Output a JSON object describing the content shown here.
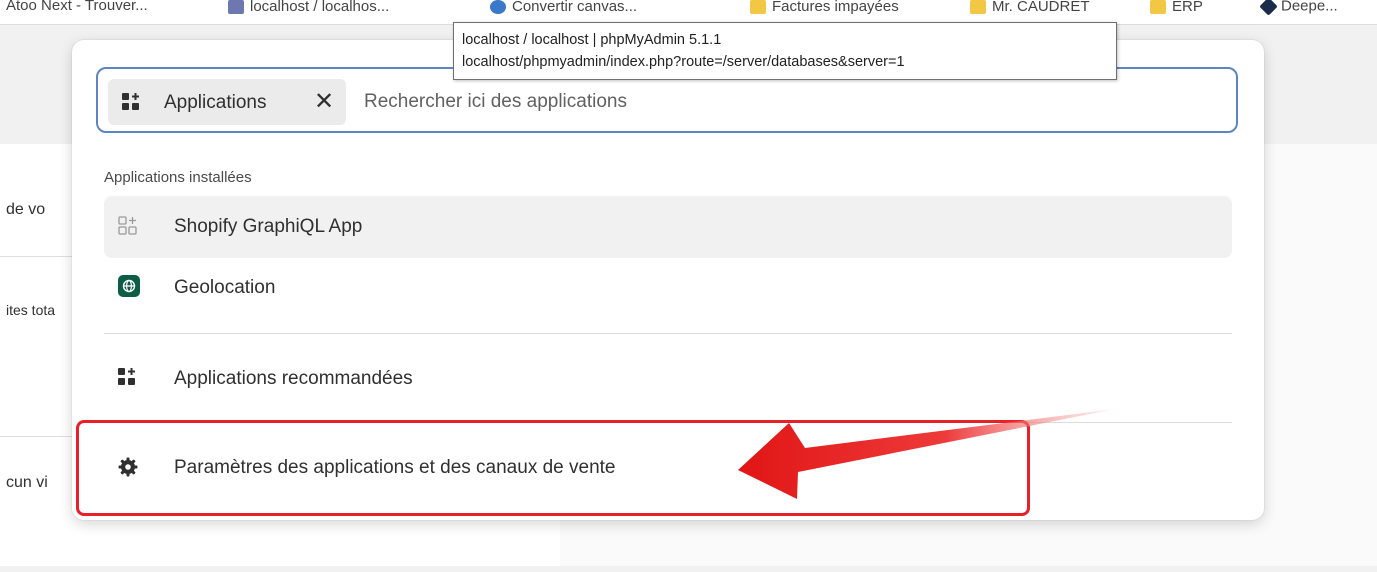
{
  "bookmarks": [
    {
      "label": "Atoo Next - Trouver...",
      "icon": "none"
    },
    {
      "label": "localhost / localhos...",
      "icon": "phpmyadmin-icon"
    },
    {
      "label": "Convertir canvas...",
      "icon": "globe-icon"
    },
    {
      "label": "Factures impayées",
      "icon": "folder-icon"
    },
    {
      "label": "Mr. CAUDRET",
      "icon": "folder-icon"
    },
    {
      "label": "ERP",
      "icon": "folder-icon"
    },
    {
      "label": "Deepe...",
      "icon": "deepl-icon"
    }
  ],
  "background": {
    "text_1": "de vo",
    "text_2": "ites tota",
    "text_3": "cun vi"
  },
  "tooltip": {
    "line1": "localhost / localhost | phpMyAdmin 5.1.1",
    "line2": "localhost/phpmyadmin/index.php?route=/server/databases&server=1"
  },
  "search": {
    "chip_label": "Applications",
    "chip_remove": "✕",
    "placeholder": "Rechercher ici des applications"
  },
  "installed": {
    "title": "Applications installées",
    "items": [
      {
        "label": "Shopify GraphiQL App",
        "icon": "app-grid-icon"
      },
      {
        "label": "Geolocation",
        "icon": "globe-icon"
      }
    ]
  },
  "links": {
    "recommended": "Applications recommandées",
    "settings": "Paramètres des applications et des canaux de vente"
  },
  "colors": {
    "accent_border": "#5d85c4",
    "highlight_red": "#e8202a",
    "geolocation_green": "#0d5c46"
  }
}
